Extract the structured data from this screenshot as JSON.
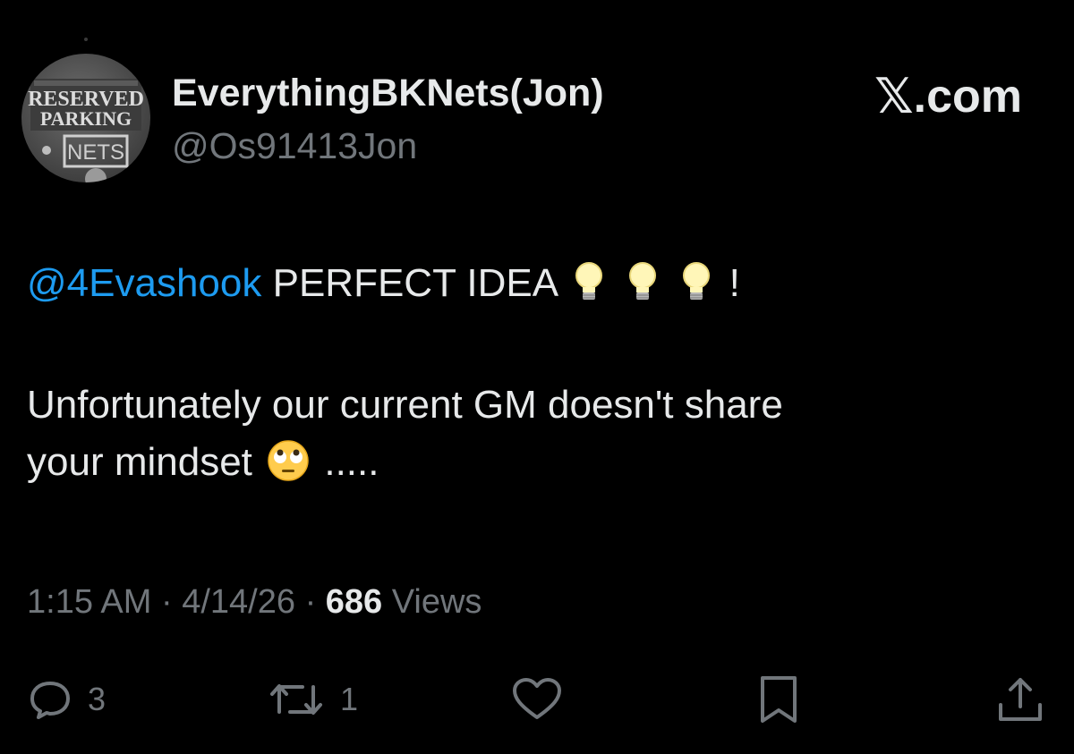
{
  "author": {
    "display_name": "EverythingBKNets(Jon)",
    "handle": "@Os91413Jon",
    "avatar_icon": "reserved-parking-nets-sign-avatar",
    "avatar_text": [
      "RESERVED",
      "PARKING",
      "NETS"
    ]
  },
  "site_mark": {
    "glyph": "𝕏",
    "label": ".com"
  },
  "tweet": {
    "mention": "@4Evashook",
    "line1_text": "PERFECT IDEA",
    "line1_end": "!",
    "line2": "Unfortunately our current GM doesn't share",
    "line3": "your mindset",
    "line3_end": ".....",
    "emojis": [
      "light-bulb-emoji",
      "light-bulb-emoji",
      "light-bulb-emoji",
      "face-with-rolling-eyes-emoji"
    ]
  },
  "meta": {
    "time": "1:15 AM",
    "separator": "·",
    "date": "4/14/26",
    "views_count": "686",
    "views_label": "Views"
  },
  "actions": {
    "reply_count": "3",
    "repost_count": "1",
    "icons": [
      "reply-icon",
      "repost-icon",
      "like-icon",
      "bookmark-icon",
      "share-icon"
    ]
  },
  "colors": {
    "background": "#000000",
    "text": "#e7e9ea",
    "secondary": "#71767b",
    "accent": "#1d9bf0"
  }
}
